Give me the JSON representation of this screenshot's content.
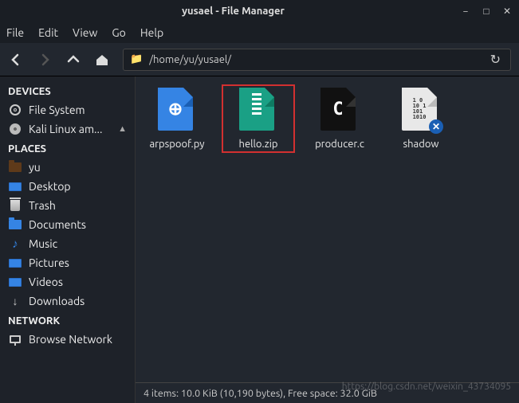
{
  "window": {
    "title": "yusael - File Manager"
  },
  "menu": {
    "file": "File",
    "edit": "Edit",
    "view": "View",
    "go": "Go",
    "help": "Help"
  },
  "location": {
    "path": "/home/yu/yusael/"
  },
  "sidebar": {
    "devices_header": "DEVICES",
    "places_header": "PLACES",
    "network_header": "NETWORK",
    "devices": [
      {
        "label": "File System"
      },
      {
        "label": "Kali Linux am...",
        "ejectable": true
      }
    ],
    "places": [
      {
        "label": "yu"
      },
      {
        "label": "Desktop"
      },
      {
        "label": "Trash"
      },
      {
        "label": "Documents"
      },
      {
        "label": "Music"
      },
      {
        "label": "Pictures"
      },
      {
        "label": "Videos"
      },
      {
        "label": "Downloads"
      }
    ],
    "network": [
      {
        "label": "Browse Network"
      }
    ]
  },
  "files": [
    {
      "name": "arpspoof.py",
      "type": "python"
    },
    {
      "name": "hello.zip",
      "type": "zip",
      "highlighted": true
    },
    {
      "name": "producer.c",
      "type": "c"
    },
    {
      "name": "shadow",
      "type": "binary",
      "error_badge": true
    }
  ],
  "status": {
    "text": "4 items: 10.0 KiB (10,190 bytes), Free space: 32.0 GiB"
  },
  "watermark": "https://blog.csdn.net/weixin_43734095"
}
